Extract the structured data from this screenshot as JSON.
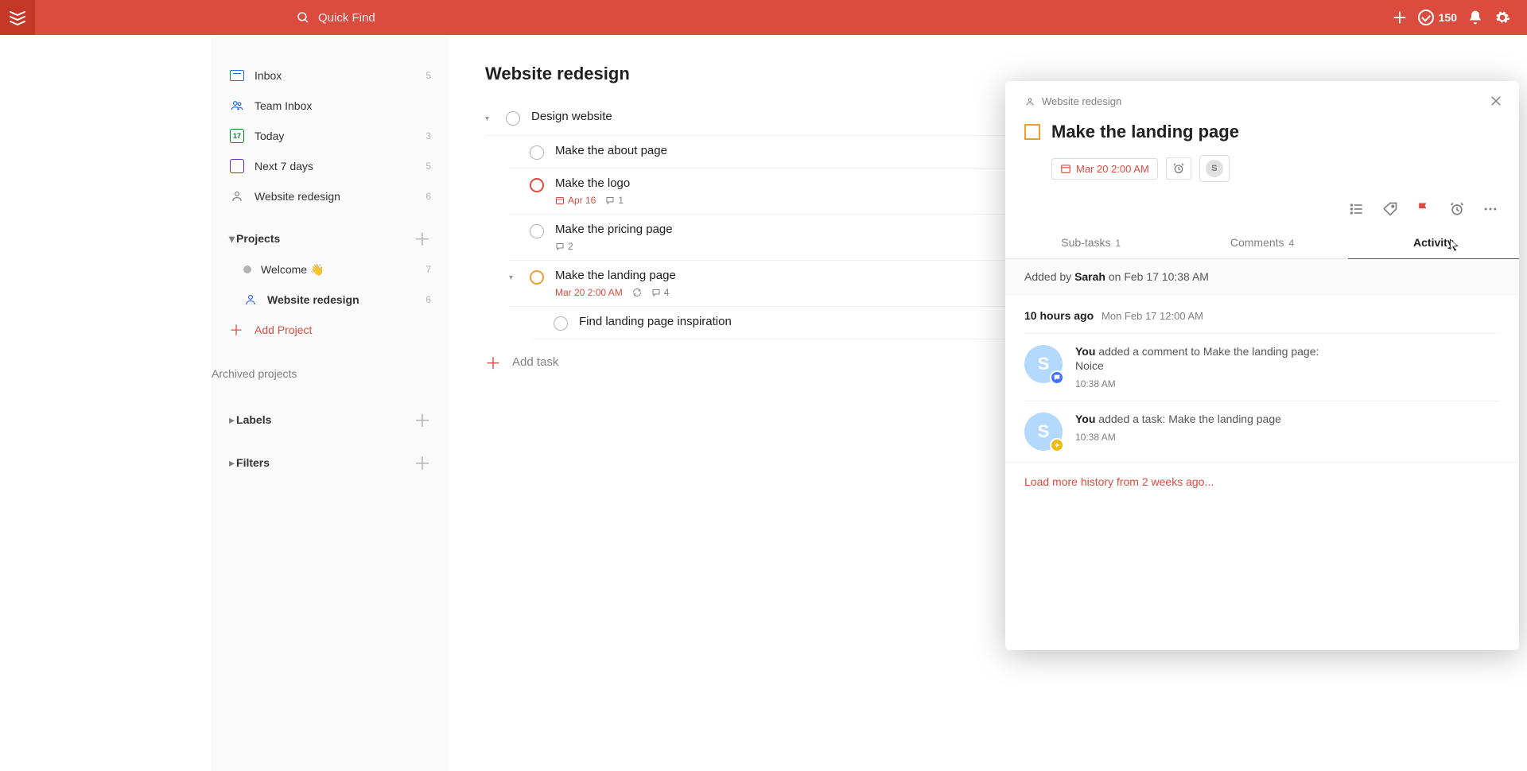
{
  "topbar": {
    "search_placeholder": "Quick Find",
    "karma_points": "150"
  },
  "sidebar": {
    "inbox": {
      "label": "Inbox",
      "count": "5"
    },
    "team_inbox": {
      "label": "Team Inbox"
    },
    "today": {
      "label": "Today",
      "count": "3",
      "date_num": "17"
    },
    "next7": {
      "label": "Next 7 days",
      "count": "5"
    },
    "project_side": {
      "label": "Website redesign",
      "count": "6"
    },
    "projects_header": "Projects",
    "projects": [
      {
        "label": "Welcome 👋",
        "count": "7"
      },
      {
        "label": "Website redesign",
        "count": "6"
      }
    ],
    "add_project": "Add Project",
    "archived": "Archived projects",
    "labels_header": "Labels",
    "filters_header": "Filters"
  },
  "main": {
    "project_title": "Website redesign",
    "tasks": {
      "design_website": "Design website",
      "about_page": "Make the about page",
      "logo": {
        "title": "Make the logo",
        "due": "Apr 16",
        "comments": "1"
      },
      "pricing": {
        "title": "Make the pricing page",
        "comments": "2"
      },
      "landing": {
        "title": "Make the landing page",
        "due": "Mar 20 2:00 AM",
        "comments": "4"
      },
      "inspiration": "Find landing page inspiration"
    },
    "add_task": "Add task"
  },
  "panel": {
    "breadcrumb_project": "Website redesign",
    "title": "Make the landing page",
    "due_chip": "Mar 20 2:00 AM",
    "assignee_initial": "S",
    "tabs": {
      "subtasks": {
        "label": "Sub-tasks",
        "count": "1"
      },
      "comments": {
        "label": "Comments",
        "count": "4"
      },
      "activity": {
        "label": "Activity"
      }
    },
    "added_by_prefix": "Added by",
    "added_by_name": "Sarah",
    "added_by_when": "on Feb 17 10:38 AM",
    "group": {
      "rel": "10 hours ago",
      "abs": "Mon Feb 17 12:00 AM"
    },
    "items": [
      {
        "actor": "You",
        "verb": "added a comment to",
        "target": "Make the landing page",
        "suffix": ":",
        "line2": "Noice",
        "time": "10:38 AM",
        "badge": "comment",
        "avatar_initial": "S"
      },
      {
        "actor": "You",
        "verb": "added a task:",
        "target": "Make the landing page",
        "suffix": "",
        "line2": "",
        "time": "10:38 AM",
        "badge": "add",
        "avatar_initial": "S"
      }
    ],
    "load_more": "Load more history from 2 weeks ago..."
  }
}
